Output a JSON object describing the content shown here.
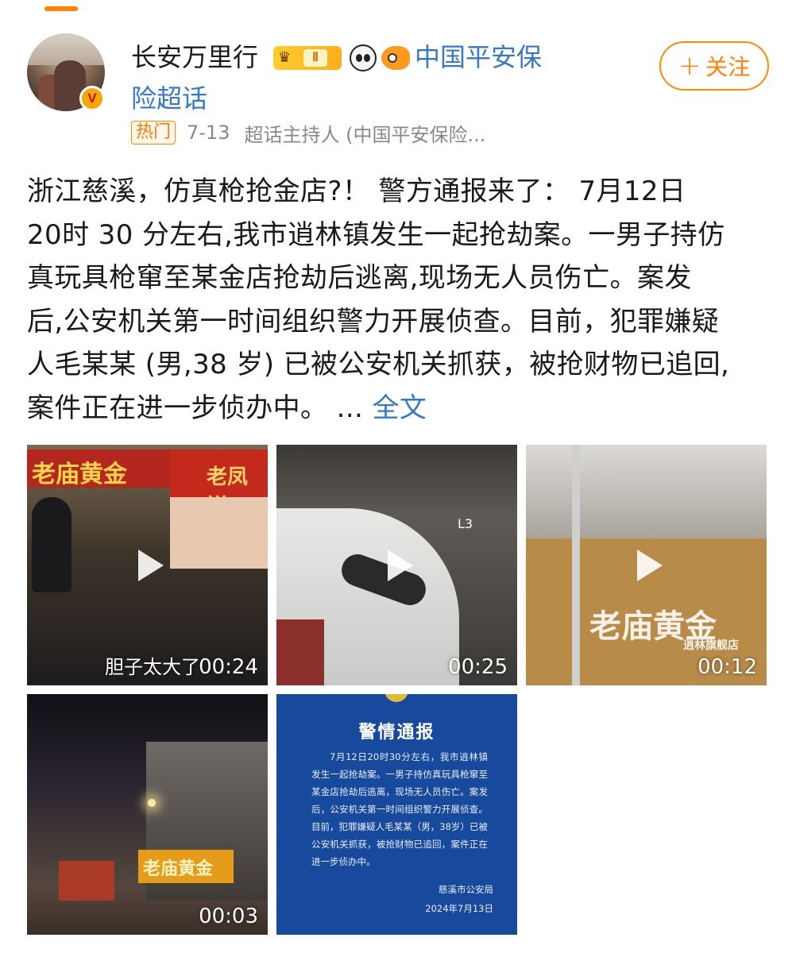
{
  "user": {
    "name": "长安万里行",
    "level_badge": "Ⅱ",
    "topic_line1": "中国平安保",
    "topic_line2": "险超话",
    "follow_label": "关注",
    "follow_plus": "+"
  },
  "meta": {
    "tag": "热门",
    "date": "7-13",
    "source": "超话主持人 (中国平安保险..."
  },
  "post": {
    "lines": [
      "浙江慈溪，仿真枪抢金店?！ 警方通报来了：  7月12日",
      "20时 30 分左右,我市逍林镇发生一起抢劫案。一男子持仿",
      "真玩具枪窜至某金店抢劫后逃离,现场无人员伤亡。案发",
      "后,公安机关第一时间组织警力开展侦查。目前，犯罪嫌疑",
      "人毛某某 (男,38 岁) 已被公安机关抓获，被抢财物已追回,",
      "案件正在进一步侦办中。  ..."
    ],
    "full_text_link": "全文"
  },
  "media": {
    "videos": [
      {
        "duration": "00:24",
        "caption": "胆子太大了",
        "sign1": "老庙黄金",
        "sign2": "老凤祥"
      },
      {
        "duration": "00:25",
        "lane_mark": "L3"
      },
      {
        "duration": "00:12",
        "sign1": "老庙黄金",
        "sign2": "逍林旗舰店"
      },
      {
        "duration": "00:03",
        "sign1": "老庙黄金"
      }
    ],
    "notice": {
      "title": "警情通报",
      "body": "7月12日20时30分左右，我市逍林镇发生一起抢劫案。一男子持仿真玩具枪窜至某金店抢劫后逃离，现场无人员伤亡。案发后，公安机关第一时间组织警力开展侦查。目前，犯罪嫌疑人毛某某（男，38岁）已被公安机关抓获，被抢财物已追回，案件正在进一步侦办中。",
      "org": "慈溪市公安局",
      "date": "2024年7月13日"
    }
  },
  "colors": {
    "accent": "#ff8200",
    "link": "#3478c6",
    "notice_bg": "#174a9c"
  }
}
